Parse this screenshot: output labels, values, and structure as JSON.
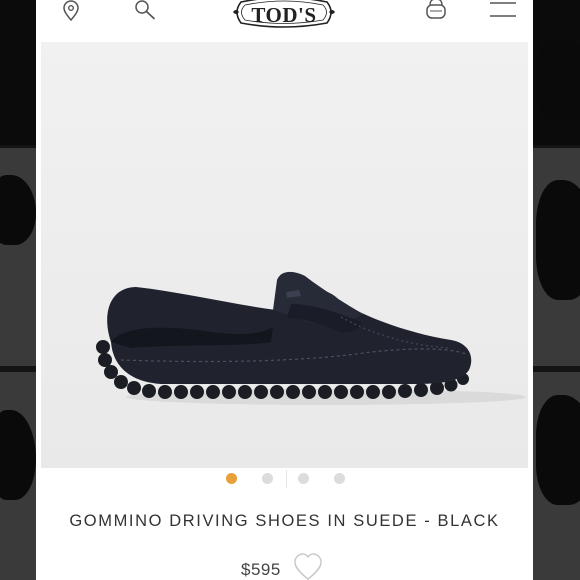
{
  "header": {
    "brand_logo": "TOD'S",
    "icons": [
      "location-pin-icon",
      "search-icon",
      "shopping-bag-icon",
      "menu-icon"
    ]
  },
  "product": {
    "title": "GOMMINO DRIVING SHOES IN SUEDE - BLACK",
    "price": "$595",
    "image_alt": "gommino-driving-shoe"
  },
  "carousel": {
    "slides": 4,
    "active_index": 0,
    "active_color": "#e8a13a",
    "inactive_color": "#dcdcdc"
  }
}
